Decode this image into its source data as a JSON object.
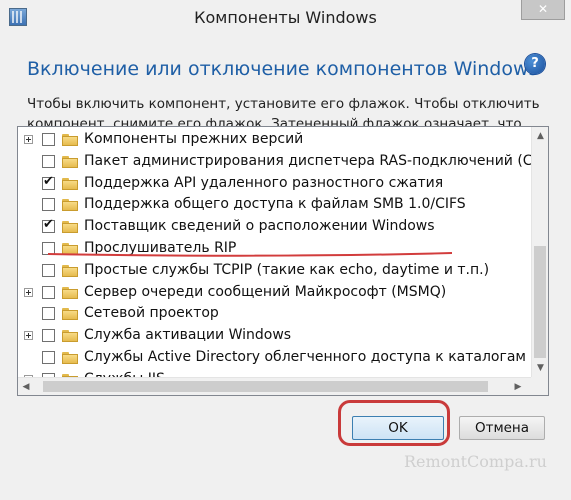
{
  "window": {
    "title": "Компоненты Windows",
    "close_icon": "✕"
  },
  "header": {
    "heading": "Включение или отключение компонентов Windows",
    "help_glyph": "?"
  },
  "description": "Чтобы включить компонент, установите его флажок. Чтобы отключить компонент, снимите его флажок. Затененный флажок означает, что компонент включен частично.",
  "features": [
    {
      "label": "Компоненты прежних версий",
      "expandable": true,
      "checked": false
    },
    {
      "label": "Пакет администрирования диспетчера RAS-подключений (CM",
      "expandable": false,
      "checked": false
    },
    {
      "label": "Поддержка API удаленного разностного сжатия",
      "expandable": false,
      "checked": true
    },
    {
      "label": "Поддержка общего доступа к файлам SMB 1.0/CIFS",
      "expandable": false,
      "checked": false
    },
    {
      "label": "Поставщик сведений о расположении Windows",
      "expandable": false,
      "checked": true
    },
    {
      "label": "Прослушиватель RIP",
      "expandable": false,
      "checked": false
    },
    {
      "label": "Простые службы TCPIP (такие как echo, daytime и т.п.)",
      "expandable": false,
      "checked": false
    },
    {
      "label": "Сервер очереди сообщений Майкрософт (MSMQ)",
      "expandable": true,
      "checked": false
    },
    {
      "label": "Сетевой проектор",
      "expandable": false,
      "checked": false
    },
    {
      "label": "Служба активации Windows",
      "expandable": true,
      "checked": false
    },
    {
      "label": "Службы Active Directory облегченного доступа к каталогам",
      "expandable": false,
      "checked": false
    },
    {
      "label": "Службы IIS",
      "expandable": true,
      "checked": false
    }
  ],
  "buttons": {
    "ok_label": "OK",
    "cancel_label": "Отмена"
  },
  "watermark": "RemontCompa.ru",
  "colors": {
    "heading": "#1f5fa6",
    "annotation_red": "#c93a3a"
  }
}
